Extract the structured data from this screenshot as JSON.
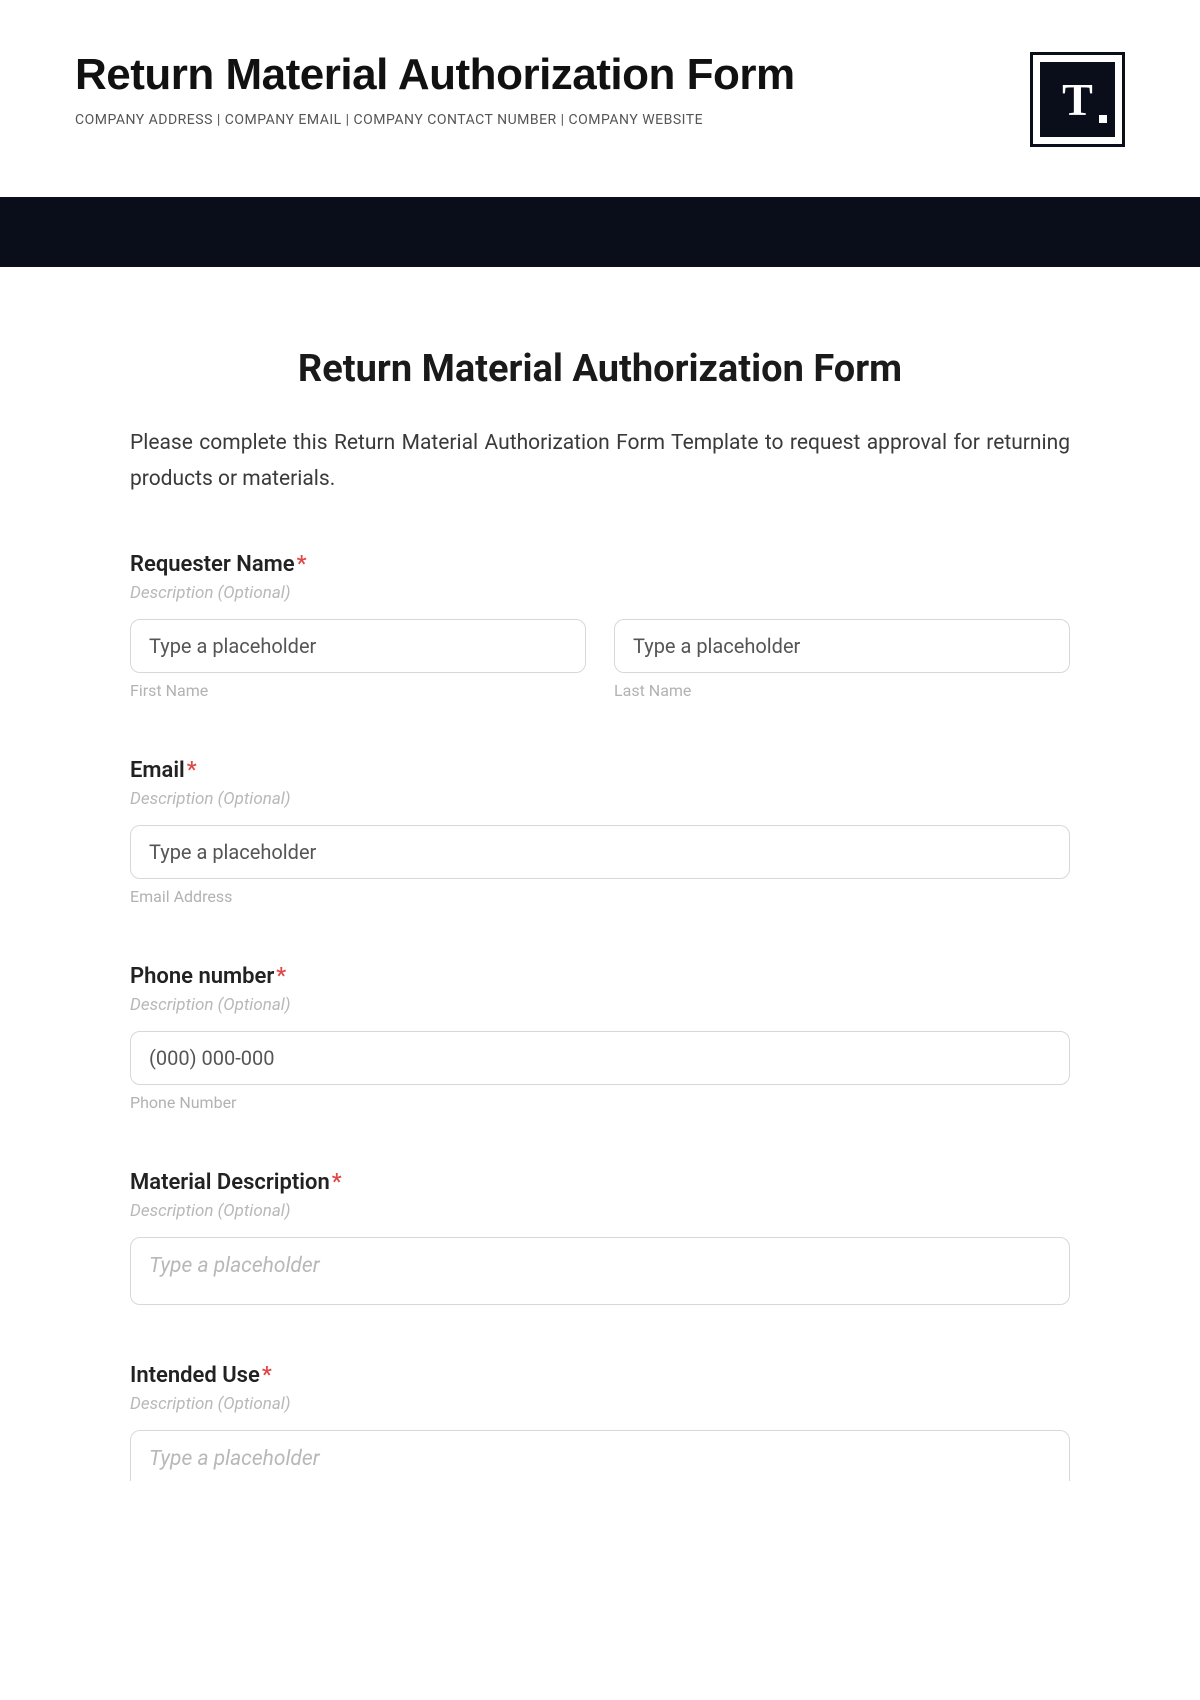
{
  "header": {
    "title": "Return Material Authorization Form",
    "subline": "COMPANY ADDRESS | COMPANY EMAIL | COMPANY CONTACT NUMBER | COMPANY WEBSITE",
    "logo_text": "T"
  },
  "form": {
    "title": "Return Material Authorization Form",
    "intro": "Please complete this Return Material Authorization Form Template to request approval for returning products or materials."
  },
  "fields": {
    "requester": {
      "label": "Requester Name",
      "desc": "Description (Optional)",
      "first_placeholder": "Type a placeholder",
      "first_sub": "First Name",
      "last_placeholder": "Type a placeholder",
      "last_sub": "Last Name"
    },
    "email": {
      "label": "Email",
      "desc": "Description (Optional)",
      "placeholder": "Type a placeholder",
      "sub": "Email Address"
    },
    "phone": {
      "label": "Phone number",
      "desc": "Description (Optional)",
      "placeholder": "(000) 000-000",
      "sub": "Phone Number"
    },
    "material": {
      "label": "Material Description",
      "desc": "Description (Optional)",
      "placeholder": "Type a placeholder"
    },
    "intended": {
      "label": "Intended Use",
      "desc": "Description (Optional)",
      "placeholder": "Type a placeholder"
    }
  },
  "required_mark": "*"
}
